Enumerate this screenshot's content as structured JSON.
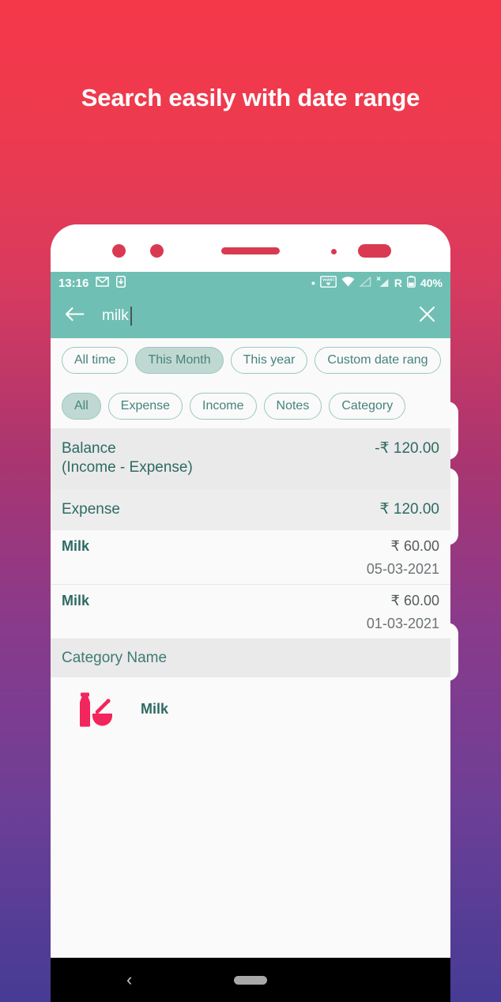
{
  "promo": {
    "headline": "Search easily with date range"
  },
  "statusbar": {
    "time": "13:16",
    "icons_left": [
      "gmail-icon",
      "download-icon"
    ],
    "dot": "•",
    "vowifi_label": "VoWiFi",
    "vowifi_sub": "2",
    "roaming": "R",
    "battery": "40%"
  },
  "appbar": {
    "back_icon": "←",
    "query": "milk",
    "clear_icon": "✕"
  },
  "date_chips": [
    {
      "label": "All time",
      "selected": false
    },
    {
      "label": "This Month",
      "selected": true
    },
    {
      "label": "This year",
      "selected": false
    },
    {
      "label": "Custom date rang",
      "selected": false
    }
  ],
  "type_chips": [
    {
      "label": "All",
      "selected": true
    },
    {
      "label": "Expense",
      "selected": false
    },
    {
      "label": "Income",
      "selected": false
    },
    {
      "label": "Notes",
      "selected": false
    },
    {
      "label": "Category",
      "selected": false
    }
  ],
  "summary": {
    "balance_label_line1": "Balance",
    "balance_label_line2": "(Income - Expense)",
    "balance_value": "-₹ 120.00",
    "expense_label": "Expense",
    "expense_value": "₹ 120.00"
  },
  "transactions": [
    {
      "name": "Milk",
      "amount": "₹ 60.00",
      "date": "05-03-2021"
    },
    {
      "name": "Milk",
      "amount": "₹ 60.00",
      "date": "01-03-2021"
    }
  ],
  "category_section": {
    "header": "Category Name",
    "items": [
      {
        "name": "Milk",
        "icon": "milk-bottle-icon"
      }
    ]
  },
  "navbar": {
    "back_icon": "‹",
    "pill": "home-pill"
  },
  "colors": {
    "teal": "#6FBFB4",
    "teal_text": "#2E6A63",
    "chip_selected": "#BFD9D2",
    "accent_red": "#F5374A",
    "gradient_end": "#463B95",
    "icon_pink": "#F2255C"
  }
}
